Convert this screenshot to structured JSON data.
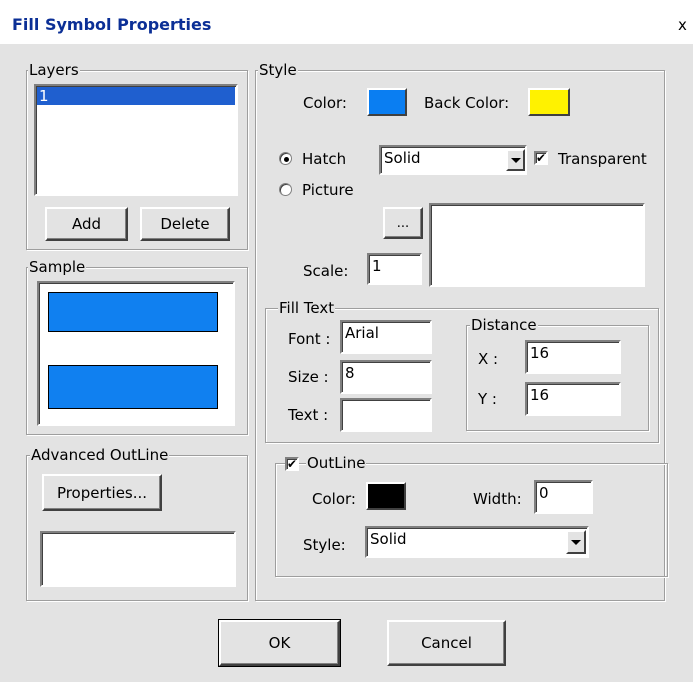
{
  "dialog": {
    "title": "Fill Symbol Properties",
    "close": "x"
  },
  "layers": {
    "label": "Layers",
    "items": [
      "1"
    ],
    "add": "Add",
    "delete": "Delete"
  },
  "sample": {
    "label": "Sample"
  },
  "advanced": {
    "label": "Advanced OutLine",
    "properties": "Properties..."
  },
  "style": {
    "label": "Style",
    "color_label": "Color:",
    "color": "#0a7ef2",
    "back_color_label": "Back Color:",
    "back_color": "#fff200",
    "hatch_label": "Hatch",
    "hatch_value": "Solid",
    "transparent_label": "Transparent",
    "picture_label": "Picture",
    "browse": "...",
    "scale_label": "Scale:",
    "scale_value": "1"
  },
  "fill_text": {
    "label": "Fill Text",
    "font_label": "Font :",
    "font_value": "Arial",
    "size_label": "Size :",
    "size_value": "8",
    "text_label": "Text :",
    "text_value": ""
  },
  "distance": {
    "label": "Distance",
    "x_label": "X :",
    "x_value": "16",
    "y_label": "Y :",
    "y_value": "16"
  },
  "outline": {
    "label": "OutLine",
    "color_label": "Color:",
    "color": "#000000",
    "width_label": "Width:",
    "width_value": "0",
    "style_label": "Style:",
    "style_value": "Solid"
  },
  "buttons": {
    "ok": "OK",
    "cancel": "Cancel"
  }
}
